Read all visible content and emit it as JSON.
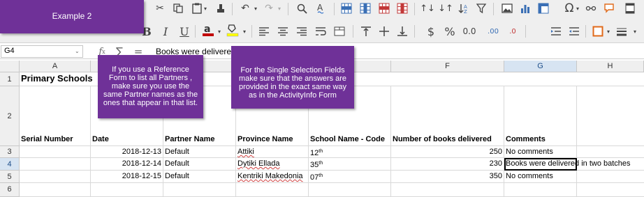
{
  "callouts": {
    "example": "Example 2",
    "partners": "If you use a Reference Form to list all Partners , make sure you use the same Partner names as the ones that appear in that list.",
    "selection": "For the Single Selection Fields make sure that the answers are provided in the exact same way as in the ActivityInfo Form"
  },
  "formula_bar": {
    "name_box": "G4",
    "content": "Books were delivered in two batches"
  },
  "columns": [
    "A",
    "B",
    "C",
    "D",
    "E",
    "F",
    "G",
    "H"
  ],
  "rows": [
    "1",
    "2",
    "3",
    "4",
    "5",
    "6"
  ],
  "sheet": {
    "title": "Primary Schools",
    "headers": {
      "serial": "Serial Number",
      "date": "Date",
      "partner": "Partner Name",
      "province": "Province Name",
      "school": "School Name - Code",
      "books": "Number of books delivered",
      "comments": "Comments"
    },
    "data": [
      {
        "date": "2018-12-13",
        "partner": "Default",
        "province": "Attiki",
        "school_base": "12",
        "school_sup": "th",
        "books": "250",
        "comments": "No comments"
      },
      {
        "date": "2018-12-14",
        "partner": "Default",
        "province": "Dytiki Ellada",
        "school_base": "35",
        "school_sup": "th",
        "books": "230",
        "comments": "Books were delivered in two batches"
      },
      {
        "date": "2018-12-15",
        "partner": "Default",
        "province": "Kentriki Makedonia",
        "school_base": "07",
        "school_sup": "th",
        "books": "350",
        "comments": "No comments"
      }
    ]
  },
  "icons": [
    "cut-icon",
    "clone-formatting-icon",
    "paste-icon",
    "clear-formatting-icon",
    "undo-icon",
    "redo-icon",
    "find-icon",
    "spelling-icon",
    "row-icon",
    "column-icon",
    "delete-row-icon",
    "delete-column-icon",
    "sort-ascending-icon",
    "sort-descending-icon",
    "sort-icon",
    "autofilter-icon",
    "image-icon",
    "chart-icon",
    "pivot-table-icon",
    "special-character-icon",
    "hyperlink-icon",
    "comment-icon",
    "headers-footers-icon",
    "bold-icon",
    "italic-icon",
    "underline-icon",
    "font-color-icon",
    "background-color-icon",
    "align-left-icon",
    "align-center-icon",
    "align-right-icon",
    "wrap-text-icon",
    "merge-cells-icon",
    "align-top-icon",
    "align-middle-icon",
    "align-bottom-icon",
    "currency-icon",
    "percent-icon",
    "number-format-icon",
    "add-decimal-icon",
    "delete-decimal-icon",
    "increase-indent-icon",
    "decrease-indent-icon",
    "borders-icon",
    "border-style-icon",
    "function-wizard-icon",
    "sum-icon",
    "formula-icon"
  ],
  "colors": {
    "callout": "#6f3198",
    "font_color_bar": "#c00000",
    "highlight_bar": "#ffff00",
    "selection_header": "#d7e4f2"
  }
}
